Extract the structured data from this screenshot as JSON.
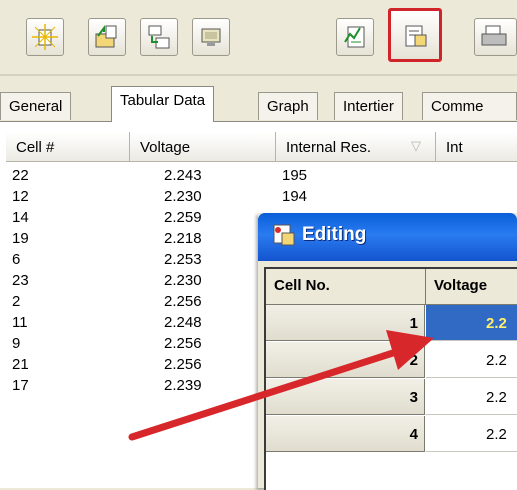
{
  "toolbar": {
    "buttons": [
      {
        "icon": "new-sparkle-icon"
      },
      {
        "icon": "open-folder-icon"
      },
      {
        "icon": "import-icon"
      },
      {
        "icon": "monitor-icon"
      },
      {
        "icon": "chart-report-icon"
      },
      {
        "icon": "edit-data-icon",
        "highlighted": true
      },
      {
        "icon": "print-icon"
      }
    ]
  },
  "tabs": [
    "General",
    "Tabular Data",
    "Graph",
    "Intertier",
    "Comme"
  ],
  "active_tab": "Tabular Data",
  "grid": {
    "columns": [
      "Cell #",
      "Voltage",
      "Internal Res.",
      "Int"
    ],
    "sort_arrow": "▽",
    "rows": [
      [
        "22",
        "2.243",
        "195"
      ],
      [
        "12",
        "2.230",
        "194"
      ],
      [
        "14",
        "2.259",
        ""
      ],
      [
        "19",
        "2.218",
        ""
      ],
      [
        "6",
        "2.253",
        ""
      ],
      [
        "23",
        "2.230",
        ""
      ],
      [
        "2",
        "2.256",
        ""
      ],
      [
        "11",
        "2.248",
        ""
      ],
      [
        "9",
        "2.256",
        ""
      ],
      [
        "21",
        "2.256",
        ""
      ],
      [
        "17",
        "2.239",
        ""
      ]
    ]
  },
  "dialog": {
    "title": "Editing",
    "columns": [
      "Cell No.",
      "Voltage"
    ],
    "rows": [
      {
        "cell": "1",
        "voltage": "2.2"
      },
      {
        "cell": "2",
        "voltage": "2.2"
      },
      {
        "cell": "3",
        "voltage": "2.2"
      },
      {
        "cell": "4",
        "voltage": "2.2"
      }
    ]
  },
  "colors": {
    "highlight": "#d0232a",
    "title_bar": "#1a62e0",
    "selection": "#316ac5",
    "arrow": "#d8272b"
  }
}
